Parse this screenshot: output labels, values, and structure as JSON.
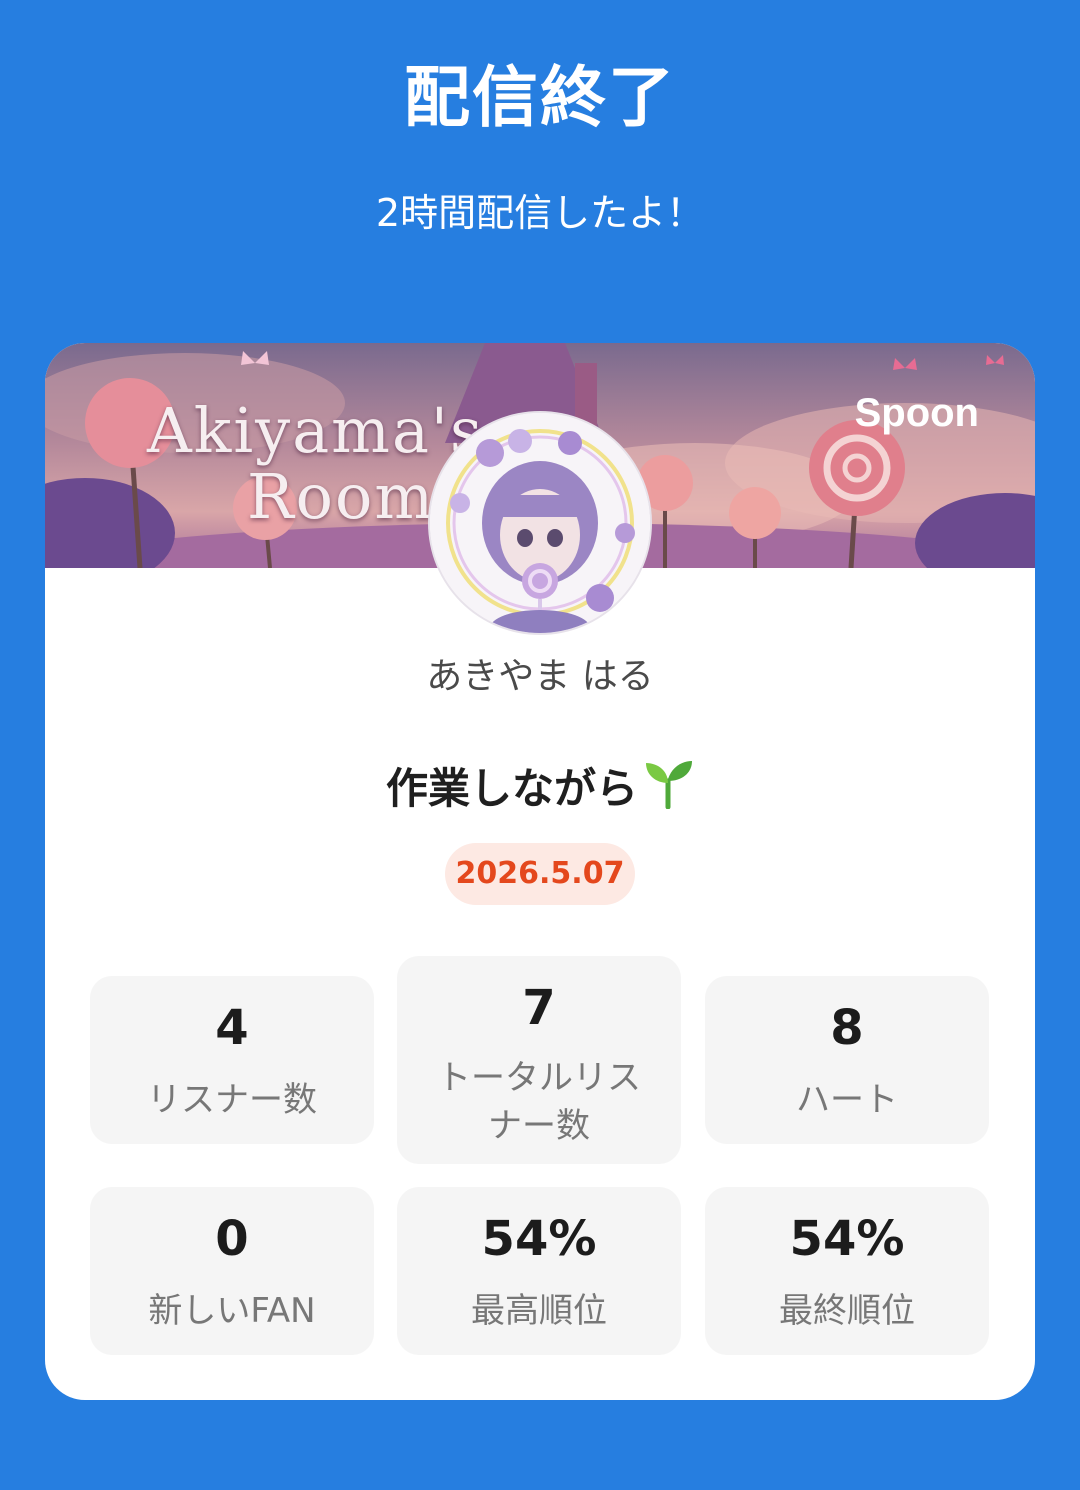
{
  "header": {
    "title": "配信終了",
    "subtitle": "2時間配信したよ！"
  },
  "banner": {
    "text_line1": "Akiyama's",
    "text_line2": "Room",
    "logo": "Spoon"
  },
  "profile": {
    "avatar_icon": "user-avatar",
    "name": "あきやま はる"
  },
  "live": {
    "title": "作業しながら",
    "title_emoji": "sprout-icon",
    "date": "2026.5.07"
  },
  "stats": [
    {
      "value": "4",
      "label": "リスナー数"
    },
    {
      "value": "7",
      "label": "トータルリスナー数"
    },
    {
      "value": "8",
      "label": "ハート"
    },
    {
      "value": "0",
      "label": "新しいFAN"
    },
    {
      "value": "54%",
      "label": "最高順位"
    },
    {
      "value": "54%",
      "label": "最終順位"
    }
  ],
  "colors": {
    "background": "#267ee0",
    "date_text": "#e4481d",
    "date_pill": "#fde9e3",
    "stat_card": "#f5f5f5"
  }
}
